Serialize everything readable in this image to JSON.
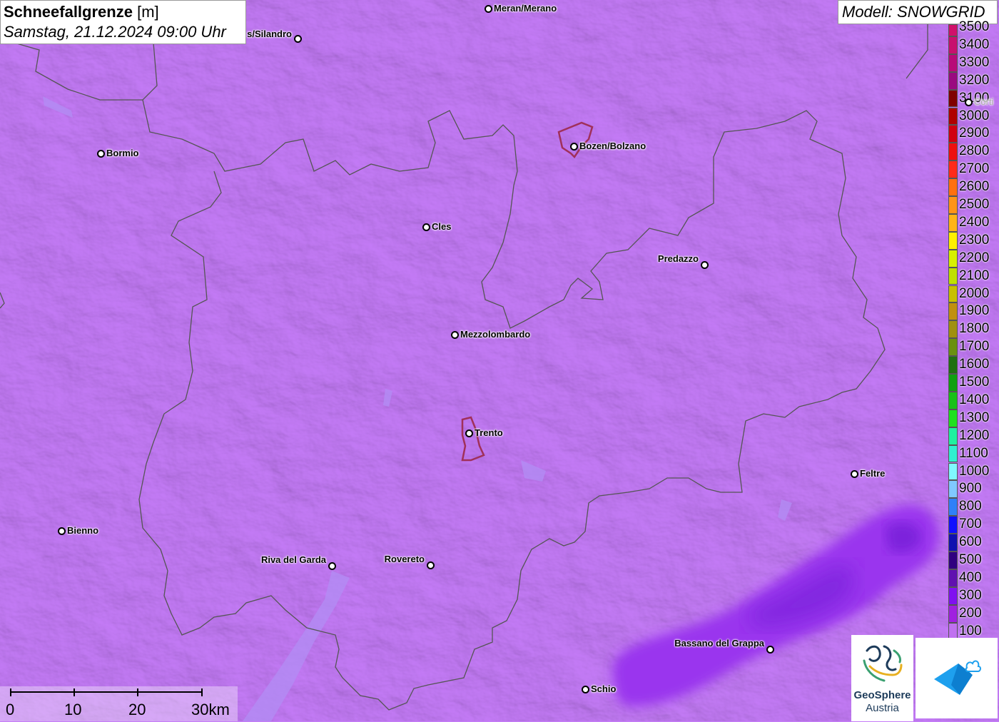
{
  "header": {
    "title_bold": "Schneefallgrenze",
    "title_unit": "[m]",
    "subtitle": "Samstag, 21.12.2024 09:00 Uhr",
    "model": "Modell: SNOWGRID"
  },
  "legend": {
    "levels": [
      {
        "label": "3500",
        "color": "#d0106a"
      },
      {
        "label": "3400",
        "color": "#c8106e"
      },
      {
        "label": "3300",
        "color": "#b80a78"
      },
      {
        "label": "3200",
        "color": "#9a0a80"
      },
      {
        "label": "3100",
        "color": "#800000"
      },
      {
        "label": "3000",
        "color": "#b00000"
      },
      {
        "label": "2900",
        "color": "#d00010"
      },
      {
        "label": "2800",
        "color": "#ee1010"
      },
      {
        "label": "2700",
        "color": "#ff2a1a"
      },
      {
        "label": "2600",
        "color": "#ff7010"
      },
      {
        "label": "2500",
        "color": "#ff9418"
      },
      {
        "label": "2400",
        "color": "#ffb418"
      },
      {
        "label": "2300",
        "color": "#fff000"
      },
      {
        "label": "2200",
        "color": "#d8f000"
      },
      {
        "label": "2100",
        "color": "#c0e000"
      },
      {
        "label": "2000",
        "color": "#c8c000"
      },
      {
        "label": "1900",
        "color": "#c09010"
      },
      {
        "label": "1800",
        "color": "#a09010"
      },
      {
        "label": "1700",
        "color": "#6a9010"
      },
      {
        "label": "1600",
        "color": "#207010"
      },
      {
        "label": "1500",
        "color": "#10a010"
      },
      {
        "label": "1400",
        "color": "#18c018"
      },
      {
        "label": "1300",
        "color": "#20e020"
      },
      {
        "label": "1200",
        "color": "#20f0a0"
      },
      {
        "label": "1100",
        "color": "#30f0d0"
      },
      {
        "label": "1000",
        "color": "#80f8ff"
      },
      {
        "label": "900",
        "color": "#80c8ff"
      },
      {
        "label": "800",
        "color": "#3080f8"
      },
      {
        "label": "700",
        "color": "#1010ff"
      },
      {
        "label": "600",
        "color": "#1010b0"
      },
      {
        "label": "500",
        "color": "#300080"
      },
      {
        "label": "400",
        "color": "#6010b0"
      },
      {
        "label": "300",
        "color": "#8010f0"
      },
      {
        "label": "200",
        "color": "#a020e0"
      },
      {
        "label": "100",
        "color": "#c070f0"
      }
    ]
  },
  "cities": [
    {
      "name": "Meran/Merano"
    },
    {
      "name": "s/Silandro"
    },
    {
      "name": "Bormio"
    },
    {
      "name": "Bozen/Bolzano"
    },
    {
      "name": "Cles"
    },
    {
      "name": "Predazzo"
    },
    {
      "name": "Mezzolombardo"
    },
    {
      "name": "Trento"
    },
    {
      "name": "Feltre"
    },
    {
      "name": "Bienno"
    },
    {
      "name": "Riva del Garda"
    },
    {
      "name": "Rovereto"
    },
    {
      "name": "Bassano del Grappa"
    },
    {
      "name": "Schio"
    },
    {
      "name": "Corti"
    }
  ],
  "scale": {
    "labels": [
      "0",
      "10",
      "20",
      "30km"
    ]
  },
  "logos": {
    "geosphere_line1": "GeoSphere",
    "geosphere_line2": "Austria"
  },
  "colors": {
    "background_level": "#c57cf8",
    "low_band": "#9a35ee",
    "low_core": "#8228e0",
    "border": "#555555",
    "urban": "#a0305a"
  }
}
